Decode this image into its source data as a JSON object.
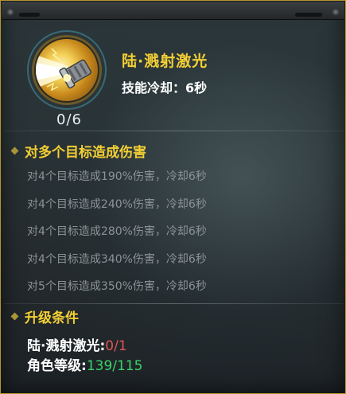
{
  "skill": {
    "name": "陆·溅射激光",
    "cooldown": "技能冷却：6秒",
    "level": "0/6",
    "icon": "laser-cannon-icon"
  },
  "effects": {
    "title": "对多个目标造成伤害",
    "items": [
      "对4个目标造成190%伤害，冷却6秒",
      "对4个目标造成240%伤害，冷却6秒",
      "对4个目标造成280%伤害，冷却6秒",
      "对4个目标造成340%伤害，冷却6秒",
      "对5个目标造成350%伤害，冷却6秒"
    ]
  },
  "upgrade": {
    "title": "升级条件",
    "req1_label": "陆·溅射激光:",
    "req1_current": "0",
    "req1_sep_max": "/1",
    "req2_label": "角色等级:",
    "req2_current": "139",
    "req2_sep_max": "/115"
  },
  "colors": {
    "title_gold": "#f3cf34",
    "fail_red": "#e05555",
    "ok_green": "#3bd36a",
    "border_gold": "#b8962e"
  }
}
